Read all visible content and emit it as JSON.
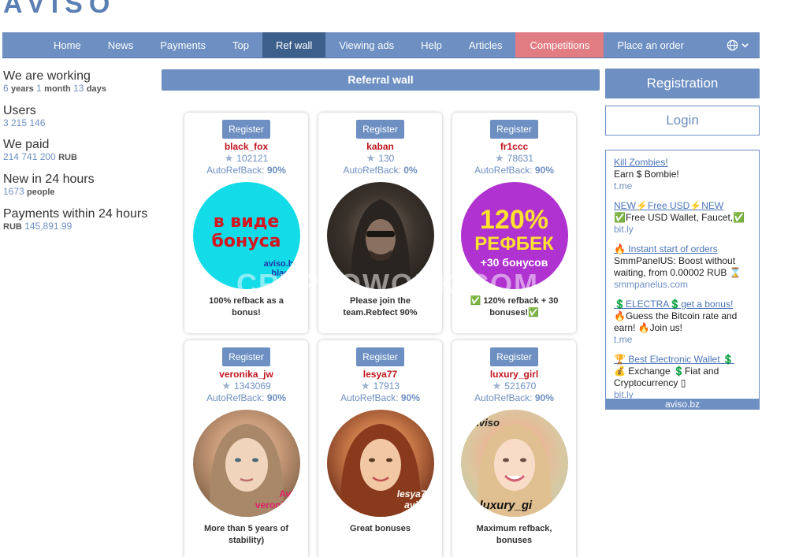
{
  "site": {
    "logo": "AVISO"
  },
  "nav": {
    "items": [
      "Home",
      "News",
      "Payments",
      "Top",
      "Ref wall",
      "Viewing ads",
      "Help",
      "Articles",
      "Competitions",
      "Place an order"
    ],
    "active": "Ref wall",
    "lang_icon": "globe-icon"
  },
  "stats": {
    "working": {
      "title": "We are working",
      "years_n": "6",
      "years": "years",
      "months_n": "1",
      "months": "month",
      "days_n": "13",
      "days": "days"
    },
    "users": {
      "title": "Users",
      "value": "3 215 146"
    },
    "paid": {
      "title": "We paid",
      "value": "214 741 200",
      "unit": "RUB"
    },
    "new24": {
      "title": "New in 24 hours",
      "value": "1673",
      "unit": "people"
    },
    "payments24": {
      "title": "Payments within 24 hours",
      "unit": "RUB",
      "value": "145,891.99"
    }
  },
  "refwall": {
    "title": "Referral wall"
  },
  "cards": [
    {
      "register": "Register",
      "name": "black_fox",
      "rating": "102121",
      "arb_label": "AutoRefBack:",
      "arb": "90%",
      "caption": "100% refback as a bonus!",
      "img_line1": "в виде",
      "img_line2": "бонуса",
      "img_tag1": "aviso.b",
      "img_tag2": "black"
    },
    {
      "register": "Register",
      "name": "kaban",
      "rating": "130",
      "arb_label": "AutoRefBack:",
      "arb": "0%",
      "caption": "Please join the team.Rebfect 90%"
    },
    {
      "register": "Register",
      "name": "fr1ccc",
      "rating": "78631",
      "arb_label": "AutoRefBack:",
      "arb": "90%",
      "caption": "✅ 120% refback + 30 bonuses!✅",
      "img_line1": "120%",
      "img_line2": "РЕФБЕК",
      "img_line3": "+30 бонусов"
    },
    {
      "register": "Register",
      "name": "veronika_jw",
      "rating": "1343069",
      "arb_label": "AutoRefBack:",
      "arb": "90%",
      "caption": "More than 5 years of stability)",
      "img_tag1": "Avi",
      "img_tag2": "veronik"
    },
    {
      "register": "Register",
      "name": "lesya77",
      "rating": "17913",
      "arb_label": "AutoRefBack:",
      "arb": "90%",
      "caption": "Great bonuses",
      "img_tag1": "lesya7",
      "img_tag2": "avis"
    },
    {
      "register": "Register",
      "name": "luxury_girl",
      "rating": "521670",
      "arb_label": "AutoRefBack:",
      "arb": "90%",
      "caption": "Maximum refback, bonuses",
      "img_tag1": "Aviso",
      "img_tag2": "luxury_gi"
    }
  ],
  "side": {
    "registration": "Registration",
    "login": "Login",
    "ads": [
      {
        "title": "Kill Zombies!",
        "text": "Earn $ Bombie!",
        "src": "t.me"
      },
      {
        "title": "NEW⚡Free USD⚡NEW",
        "text": "✅Free USD Wallet, Faucet,✅",
        "src": "bit.ly"
      },
      {
        "title": "🔥 Instant start of orders",
        "text": "SmmPanelUS: Boost without waiting, from 0.00002 RUB ⌛",
        "src": "smmpanelus.com"
      },
      {
        "title": "💲ELECTRA💲get a bonus!",
        "text": "🔥Guess the Bitcoin rate and earn! 🔥Join us!",
        "src": "t.me"
      },
      {
        "title": "🏆 Best Electronic Wallet 💲",
        "text": "💰 Exchange 💲Fiat and Cryptocurrency ▯",
        "src": "bit.ly"
      }
    ],
    "ads_footer": "aviso.bz"
  },
  "watermark": "CRYPTOWORK.COM",
  "colors": {
    "primary": "#6d8fc2",
    "active": "#3d5f8c",
    "competitions": "#e27c83",
    "username": "#c0161f"
  }
}
